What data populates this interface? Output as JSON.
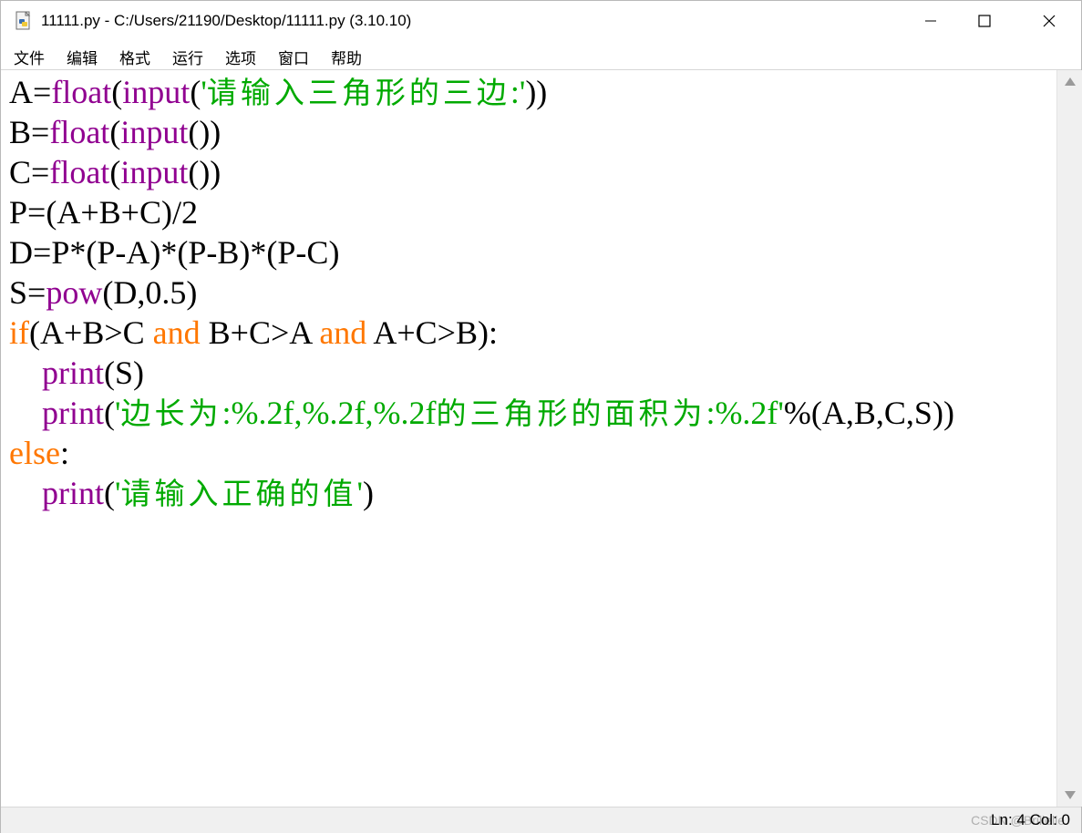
{
  "window": {
    "title": "11111.py - C:/Users/21190/Desktop/11111.py (3.10.10)",
    "app_icon": "python-file-icon",
    "controls": {
      "minimize": "minimize-icon",
      "maximize": "maximize-icon",
      "close": "close-icon"
    }
  },
  "menu": {
    "items": [
      "文件",
      "编辑",
      "格式",
      "运行",
      "选项",
      "窗口",
      "帮助"
    ]
  },
  "editor": {
    "colors": {
      "keyword": "#ff7700",
      "builtin": "#900090",
      "string": "#00aa00",
      "text": "#000000"
    },
    "lines": [
      "A=float(input('请输入三角形的三边:'))",
      "B=float(input())",
      "C=float(input())",
      "P=(A+B+C)/2",
      "D=P*(P-A)*(P-B)*(P-C)",
      "S=pow(D,0.5)",
      "if(A+B>C and B+C>A and A+C>B):",
      "    print(S)",
      "    print('边长为:%.2f,%.2f,%.2f的三角形的面积为:%.2f'%(A,B,C,S))",
      "else:",
      "    print('请输入正确的值')"
    ]
  },
  "status": {
    "position": "Ln: 4  Col: 0",
    "watermark": "CSDN @Brillelle"
  }
}
